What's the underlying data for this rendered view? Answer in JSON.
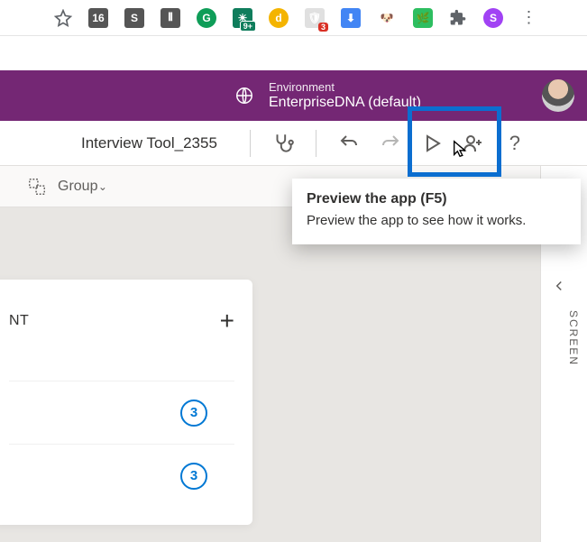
{
  "chrome": {
    "star": "star-icon",
    "extensions": [
      "16",
      "S",
      "⦀",
      "G",
      "☀",
      "d",
      "🛡",
      "⬇",
      "🐶",
      "🌿",
      "✦",
      "S",
      "⋮"
    ],
    "badge_3": "3",
    "badge_9": "9+"
  },
  "env": {
    "label": "Environment",
    "name": "EnterpriseDNA (default)"
  },
  "cmd": {
    "app_title": "Interview Tool_2355",
    "help": "?"
  },
  "fmt": {
    "group_label": "Group"
  },
  "tooltip": {
    "title": "Preview the app (F5)",
    "body": "Preview the app to see how it works."
  },
  "panel": {
    "title_fragment": "NT",
    "count_a": "3",
    "count_b": "3"
  },
  "right": {
    "vert_label": "SCREEN"
  }
}
